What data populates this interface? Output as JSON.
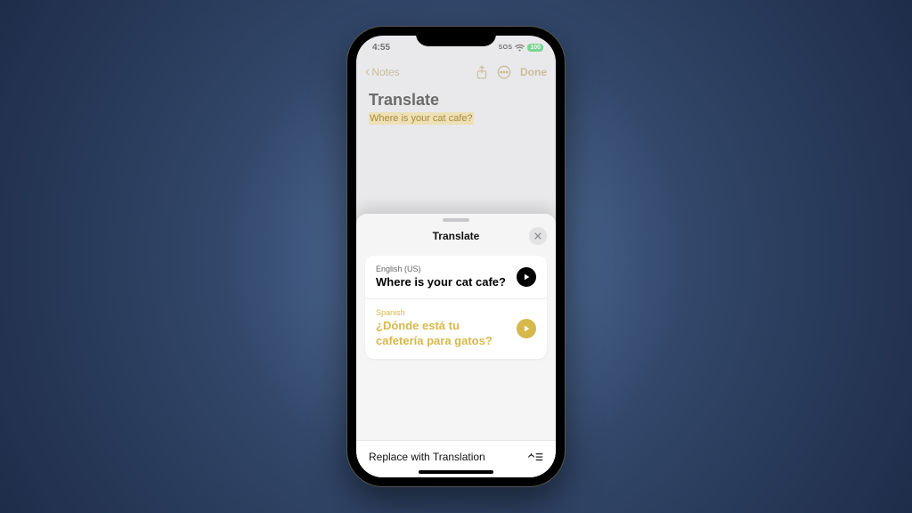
{
  "status": {
    "time": "4:55",
    "sos": "SOS",
    "battery": "100"
  },
  "nav": {
    "back_label": "Notes",
    "done_label": "Done"
  },
  "note": {
    "title": "Translate",
    "text": "Where is your cat cafe?"
  },
  "sheet": {
    "title": "Translate",
    "source": {
      "lang": "English (US)",
      "text": "Where is your cat cafe?"
    },
    "target": {
      "lang": "Spanish",
      "text": "¿Dónde está tu cafetería para gatos?"
    },
    "replace_label": "Replace with Translation"
  },
  "colors": {
    "accent": "#d6b84b",
    "sheet_bg": "#f5f5f6"
  }
}
